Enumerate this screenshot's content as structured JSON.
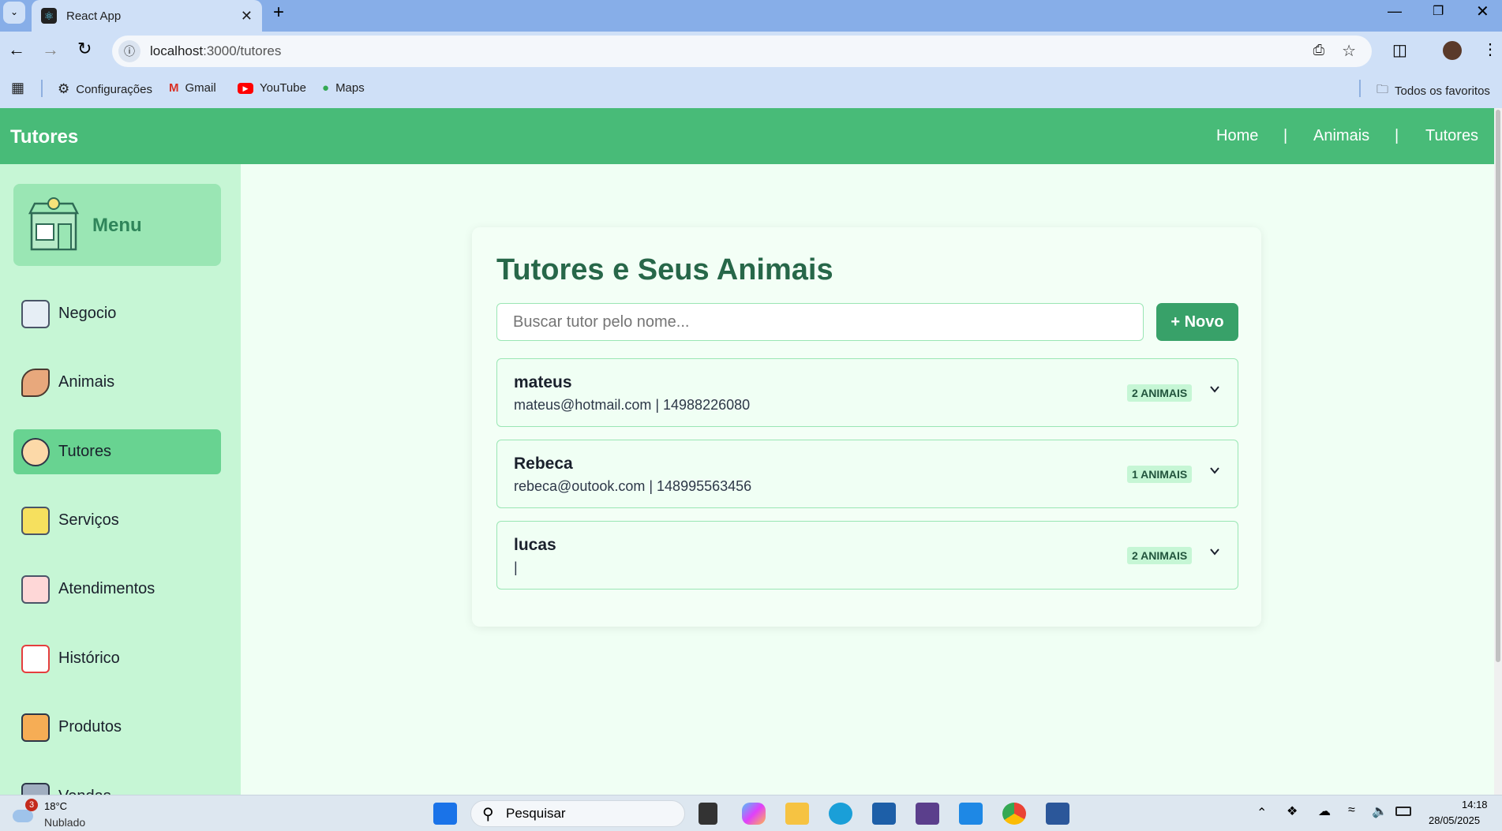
{
  "browser": {
    "tab_title": "React App",
    "url_host": "localhost",
    "url_path": ":3000/tutores",
    "bookmarks": [
      "Configurações",
      "Gmail",
      "YouTube",
      "Maps"
    ],
    "all_bookmarks": "Todos os favoritos"
  },
  "header": {
    "title": "Tutores",
    "nav": [
      "Home",
      "Animais",
      "Tutores"
    ],
    "separator": "|"
  },
  "sidebar": {
    "menu_label": "Menu",
    "items": [
      {
        "label": "Negocio",
        "icon": "business-icon"
      },
      {
        "label": "Animais",
        "icon": "dog-icon"
      },
      {
        "label": "Tutores",
        "icon": "tutor-avatar-icon",
        "active": true
      },
      {
        "label": "Serviços",
        "icon": "clipboard-icon"
      },
      {
        "label": "Atendimentos",
        "icon": "medical-clipboard-icon"
      },
      {
        "label": "Histórico",
        "icon": "calendar-clock-icon"
      },
      {
        "label": "Produtos",
        "icon": "shelf-icon"
      },
      {
        "label": "Vendas",
        "icon": "register-icon"
      }
    ]
  },
  "main": {
    "title": "Tutores e Seus Animais",
    "search_placeholder": "Buscar tutor pelo nome...",
    "new_button": "+ Novo",
    "tutors": [
      {
        "name": "mateus",
        "info": "mateus@hotmail.com | 14988226080",
        "badge": "2 ANIMAIS"
      },
      {
        "name": "Rebeca",
        "info": "rebeca@outook.com | 148995563456",
        "badge": "1 ANIMAIS"
      },
      {
        "name": "lucas",
        "info": "|",
        "badge": "2 ANIMAIS"
      }
    ]
  },
  "taskbar": {
    "weather_temp": "18°C",
    "weather_desc": "Nublado",
    "weather_badge": "3",
    "search": "Pesquisar",
    "time": "14:18",
    "date": "28/05/2025"
  },
  "colors": {
    "header": "#48bb78",
    "title": "#276749",
    "button": "#38a169",
    "border": "#9ae6b4",
    "sidebar": "#c6f6d5"
  }
}
